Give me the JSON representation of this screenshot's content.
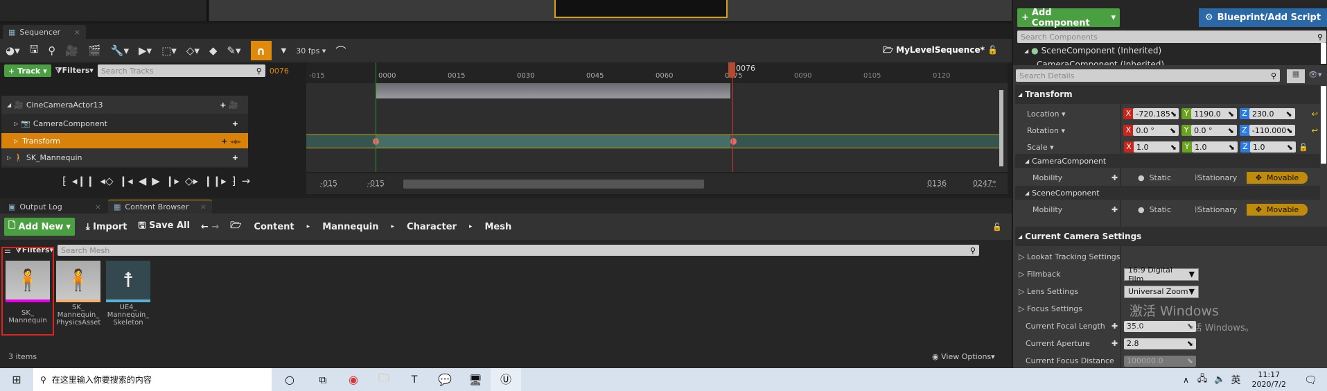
{
  "sequencer": {
    "tab": "Sequencer",
    "fps": "30 fps",
    "sequence_name": "MyLevelSequence*",
    "track_button": "Track",
    "filters": "Filters",
    "search_placeholder": "Search Tracks",
    "current_frame": "0076",
    "ticks": [
      "-015",
      "0000",
      "0015",
      "0030",
      "0045",
      "0060",
      "0075",
      "0090",
      "0105",
      "0120"
    ],
    "playhead_label": "0076",
    "tracks": [
      {
        "label": "CineCameraActor13"
      },
      {
        "label": "CameraComponent"
      },
      {
        "label": "Transform"
      },
      {
        "label": "SK_Mannequin"
      }
    ],
    "range": {
      "start_view": "-015",
      "start_play": "-015",
      "end_play": "0136",
      "end_view": "0247*"
    }
  },
  "bottom_tabs": [
    {
      "label": "Output Log"
    },
    {
      "label": "Content Browser"
    }
  ],
  "content_browser": {
    "add_new": "Add New",
    "import": "Import",
    "save_all": "Save All",
    "breadcrumb": [
      "Content",
      "Mannequin",
      "Character",
      "Mesh"
    ],
    "filters": "Filters",
    "search_placeholder": "Search Mesh",
    "assets": [
      {
        "name": "SK_ Mannequin",
        "color": "#e600e6"
      },
      {
        "name": "SK_ Mannequin_ PhysicsAsset",
        "color": "#f0b070"
      },
      {
        "name": "UE4_ Mannequin_ Skeleton",
        "color": "#5ab0d0"
      }
    ],
    "item_count": "3 items",
    "view_options": "View Options"
  },
  "details": {
    "add_component": "Add Component",
    "blueprint": "Blueprint/Add Script",
    "search_components": "Search Components",
    "components": [
      "SceneComponent (Inherited)",
      "CameraComponent (Inherited)"
    ],
    "search_details": "Search Details",
    "transform": {
      "header": "Transform",
      "location": {
        "label": "Location",
        "x": "-720.185",
        "y": "1190.0",
        "z": "230.0"
      },
      "rotation": {
        "label": "Rotation",
        "x": "0.0 °",
        "y": "0.0 °",
        "z": "-110.000"
      },
      "scale": {
        "label": "Scale",
        "x": "1.0",
        "y": "1.0",
        "z": "1.0"
      }
    },
    "sections": [
      {
        "header": "CameraComponent",
        "mobility": "Mobility"
      },
      {
        "header": "SceneComponent",
        "mobility": "Mobility"
      }
    ],
    "mobility_options": [
      "Static",
      "Stationary",
      "Movable"
    ],
    "camera": {
      "header": "Current Camera Settings",
      "lookat": "Lookat Tracking Settings",
      "filmback": "Filmback",
      "filmback_value": "16:9 Digital Film",
      "lens": "Lens Settings",
      "lens_value": "Universal Zoom",
      "focus": "Focus Settings",
      "focal_length": "Current Focal Length",
      "focal_length_value": "35.0",
      "aperture": "Current Aperture",
      "aperture_value": "2.8",
      "focus_distance": "Current Focus Distance",
      "focus_distance_value": "100000.0"
    }
  },
  "watermark": {
    "title": "激活 Windows",
    "subtitle": "转到“设置”以激活 Windows。"
  },
  "taskbar": {
    "search_placeholder": "在这里输入你要搜索的内容",
    "ime": "英",
    "time": "11:17",
    "date": "2020/7/2"
  }
}
